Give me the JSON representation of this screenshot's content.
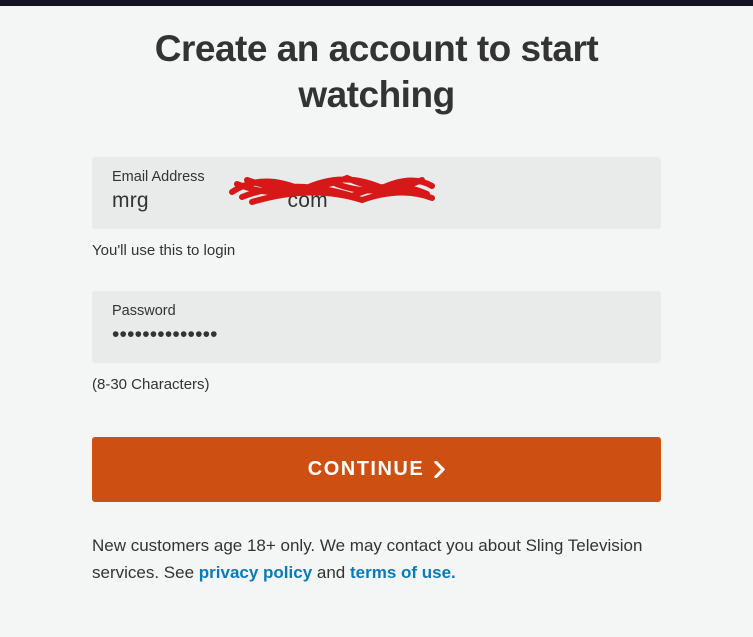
{
  "header": {
    "title": "Create an account to start watching"
  },
  "form": {
    "email": {
      "label": "Email Address",
      "value": "mrg                       com",
      "helper": "You'll use this to login"
    },
    "password": {
      "label": "Password",
      "value": "••••••••••••••",
      "helper": "(8-30 Characters)"
    },
    "continue_label": "CONTINUE"
  },
  "disclaimer": {
    "prefix": "New customers age 18+ only. We may contact you about Sling Television services. See ",
    "privacy_label": "privacy policy",
    "and": " and ",
    "terms_label": "terms of use."
  }
}
